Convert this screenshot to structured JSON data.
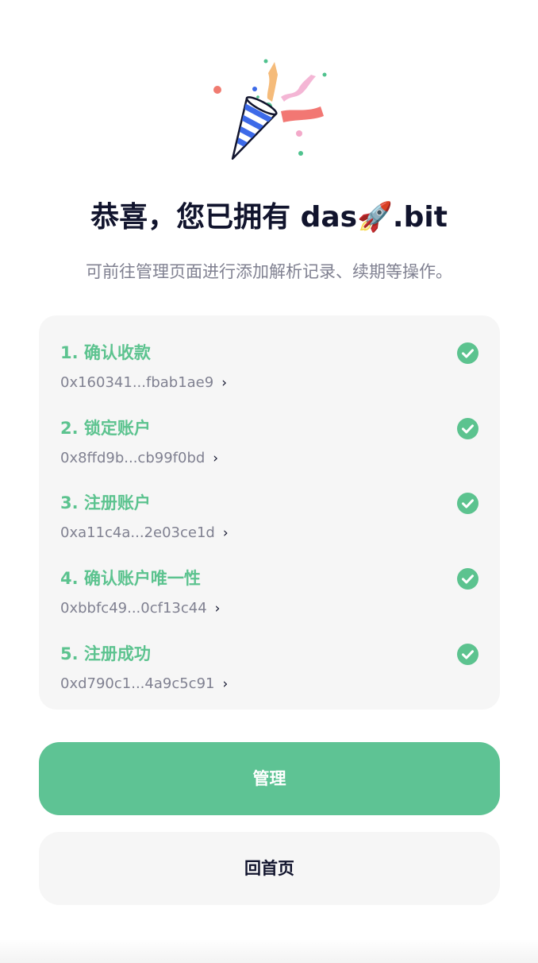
{
  "header": {
    "icon": "party-popper-icon",
    "title": "恭喜，您已拥有 das🚀.bit",
    "subtitle": "可前往管理页面进行添加解析记录、续期等操作。"
  },
  "steps": [
    {
      "title": "1. 确认收款",
      "tx": "0x160341...fbab1ae9",
      "status": "done"
    },
    {
      "title": "2. 锁定账户",
      "tx": "0x8ffd9b...cb99f0bd",
      "status": "done"
    },
    {
      "title": "3. 注册账户",
      "tx": "0xa11c4a...2e03ce1d",
      "status": "done"
    },
    {
      "title": "4. 确认账户唯一性",
      "tx": "0xbbfc49...0cf13c44",
      "status": "done"
    },
    {
      "title": "5. 注册成功",
      "tx": "0xd790c1...4a9c5c91",
      "status": "done"
    }
  ],
  "actions": {
    "manage_label": "管理",
    "home_label": "回首页"
  },
  "colors": {
    "accent": "#5ec394",
    "step_title": "#5cc38f",
    "card_bg": "#f6f6f6",
    "text_dark": "#11142d",
    "text_muted": "#808191"
  }
}
